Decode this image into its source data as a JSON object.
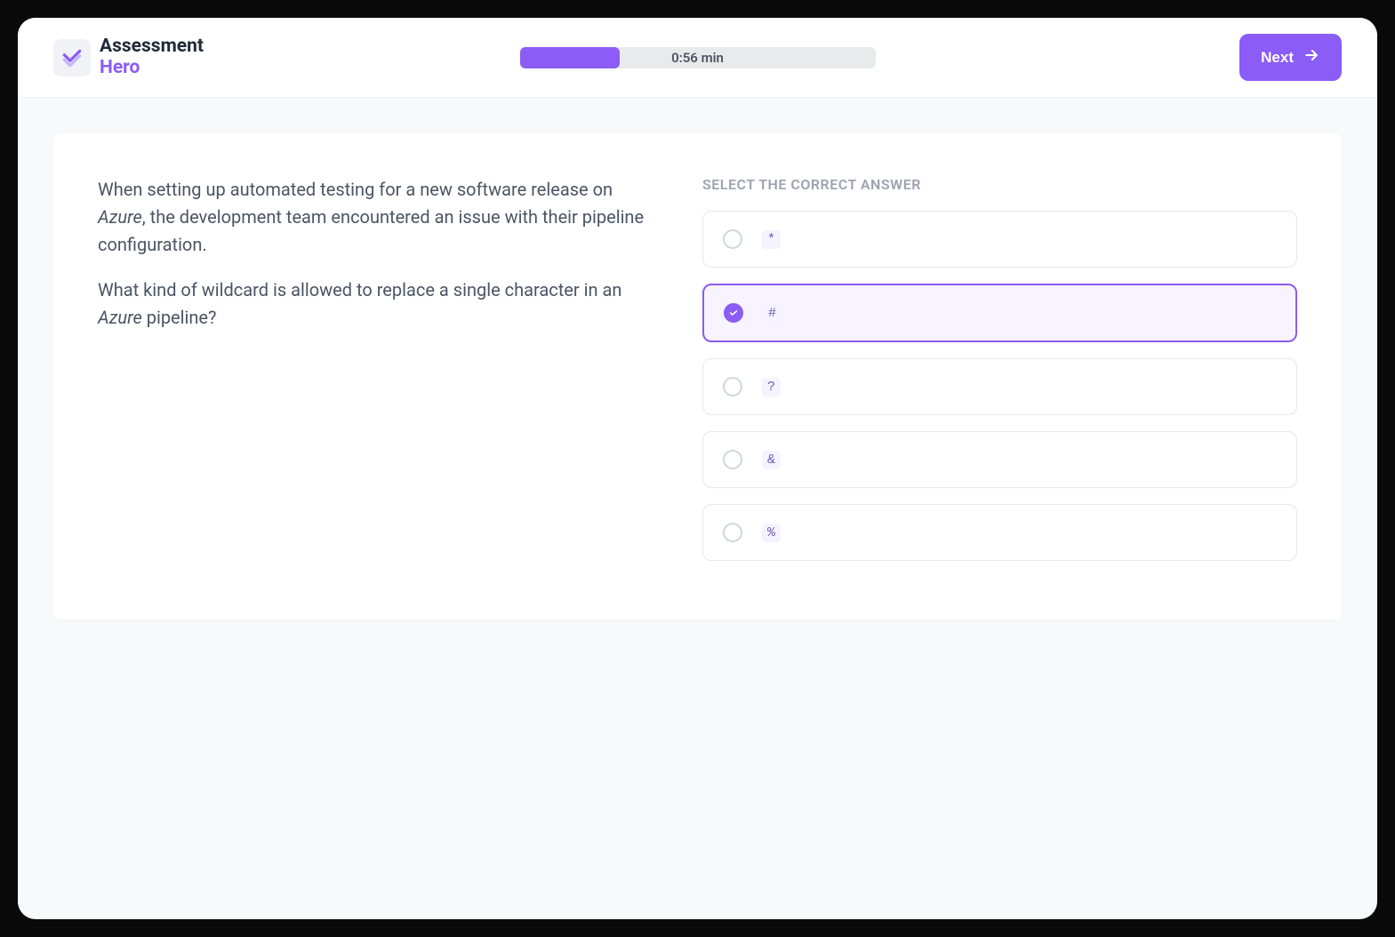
{
  "header": {
    "logo_line1": "Assessment",
    "logo_line2": "Hero",
    "timer": "0:56 min",
    "next_label": "Next"
  },
  "question": {
    "p1_pre": "When setting up automated testing for a new software release on ",
    "p1_em": "Azure",
    "p1_post": ", the development team encountered an issue with their pipeline configuration.",
    "p2_pre": "What kind of wildcard is allowed to replace a single character in an ",
    "p2_em": "Azure",
    "p2_post": " pipeline?"
  },
  "answers": {
    "title": "SELECT THE CORRECT ANSWER",
    "options": [
      "*",
      "#",
      "?",
      "&",
      "%"
    ],
    "selected_index": 1
  }
}
